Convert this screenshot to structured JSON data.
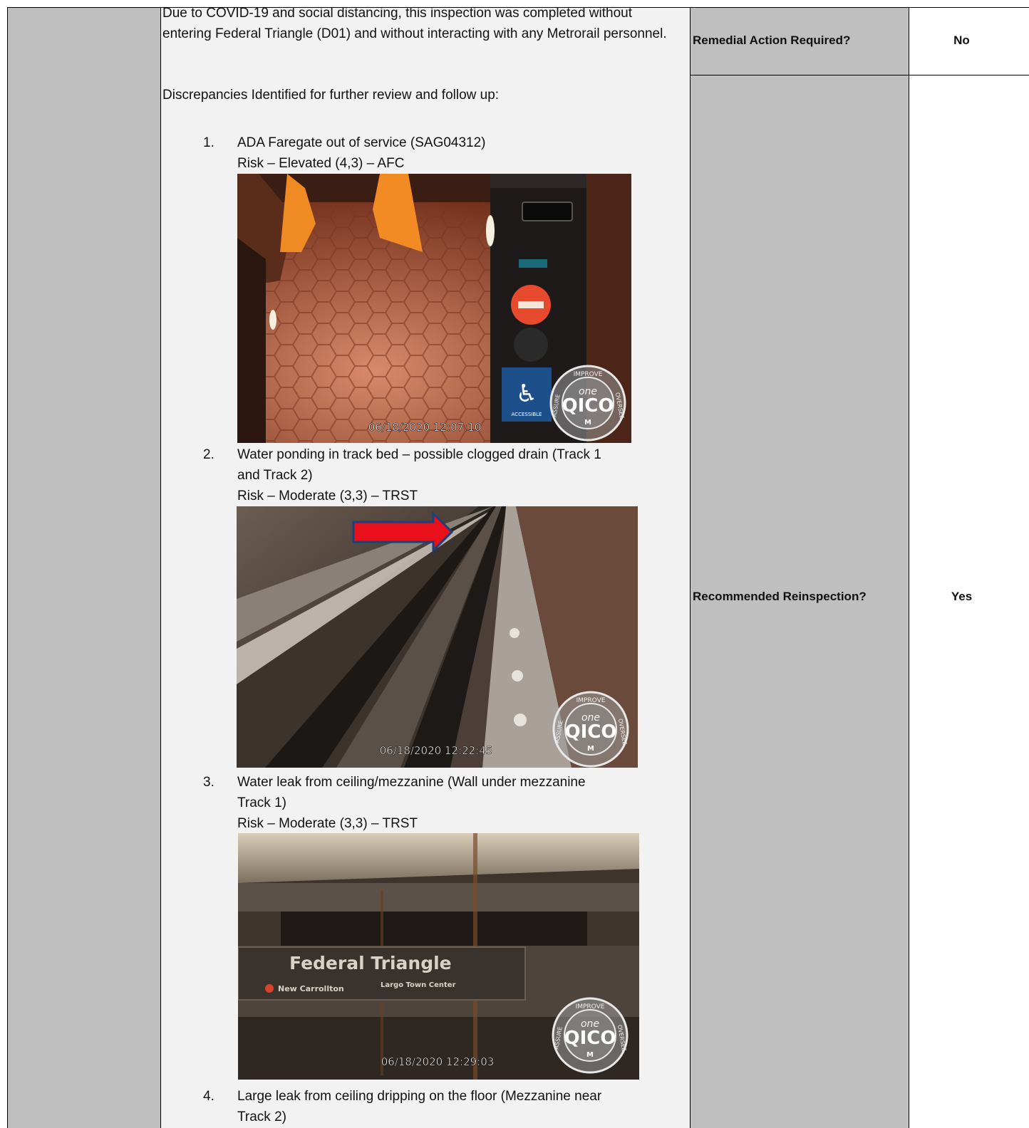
{
  "intro": "Due to COVID-19 and social distancing, this inspection was completed without entering Federal Triangle (D01) and without interacting with any Metrorail personnel.",
  "discrepancies_heading": "Discrepancies Identified for further review and follow up:",
  "remedial": {
    "label": "Remedial Action Required?",
    "value": "No"
  },
  "reinspection": {
    "label": "Recommended Reinspection?",
    "value": "Yes"
  },
  "items": [
    {
      "number": "1.",
      "title_lines": [
        "ADA Faregate out of service (SAG04312)"
      ],
      "risk": "Risk – Elevated (4,3) – AFC",
      "photo": {
        "timestamp": "06/18/2020 12:07:10",
        "icon": "accessibility-icon",
        "sign_text": "ACCESSIBLE"
      }
    },
    {
      "number": "2.",
      "title_lines": [
        "Water ponding in track bed – possible clogged drain (Track 1",
        "and Track 2)"
      ],
      "risk": "Risk – Moderate (3,3) – TRST",
      "photo": {
        "timestamp": "06/18/2020 12:22:45",
        "arrow_color": "#e8101a"
      }
    },
    {
      "number": "3.",
      "title_lines": [
        "Water leak from ceiling/mezzanine (Wall under mezzanine",
        "Track 1)"
      ],
      "risk": "Risk – Moderate (3,3) – TRST",
      "photo": {
        "timestamp": "06/18/2020 12:29:03",
        "sign_title": "Federal Triangle",
        "sign_sub_left": "New Carrollton",
        "sign_sub_right": "Largo Town Center"
      }
    },
    {
      "number": "4.",
      "title_lines": [
        "Large leak from ceiling dripping on the floor (Mezzanine near",
        "Track 2)"
      ]
    }
  ],
  "watermark": {
    "top": "IMPROVE",
    "left": "ASSURE",
    "right": "OVERSEE",
    "word": "one",
    "brand": "QICO",
    "badge": "M"
  }
}
